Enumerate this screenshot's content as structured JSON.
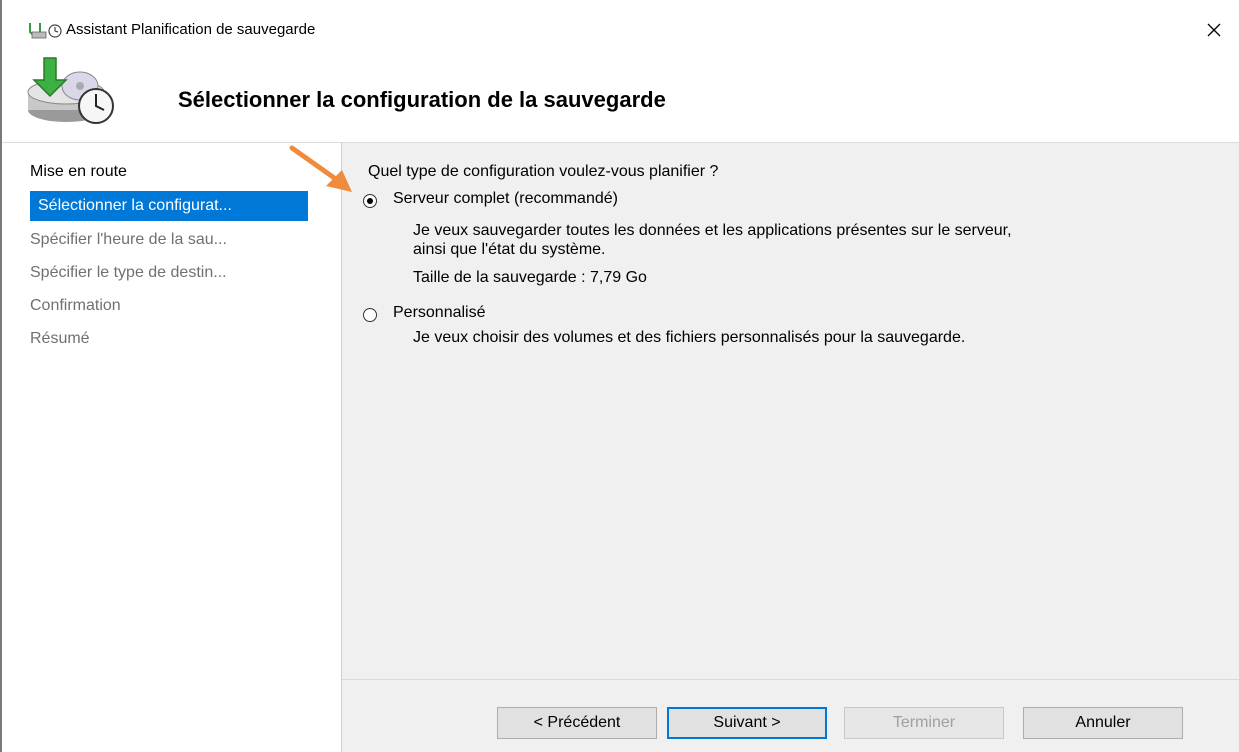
{
  "window": {
    "title": "Assistant Planification de sauvegarde",
    "close_label": "×"
  },
  "header": {
    "title": "Sélectionner la configuration de la sauvegarde"
  },
  "sidebar": {
    "items": [
      {
        "label": "Mise en route"
      },
      {
        "label": "Sélectionner la configurat..."
      },
      {
        "label": "Spécifier l'heure de la sau..."
      },
      {
        "label": "Spécifier le type de destin..."
      },
      {
        "label": "Confirmation"
      },
      {
        "label": "Résumé"
      }
    ]
  },
  "content": {
    "question": "Quel type de configuration voulez-vous planifier ?",
    "options": [
      {
        "label": "Serveur complet (recommandé)",
        "description_line1": "Je veux sauvegarder toutes les données et les applications présentes sur le serveur,",
        "description_line2": "ainsi que l'état du système.",
        "size_text": "Taille de la sauvegarde : 7,79 Go",
        "selected": true
      },
      {
        "label": "Personnalisé",
        "description_line1": "Je veux choisir des volumes et des fichiers personnalisés pour la sauvegarde.",
        "selected": false
      }
    ]
  },
  "buttons": {
    "previous": "< Précédent",
    "next": "Suivant >",
    "finish": "Terminer",
    "cancel": "Annuler"
  },
  "colors": {
    "accent": "#0078d7",
    "annotation_arrow": "#f08a3c"
  }
}
